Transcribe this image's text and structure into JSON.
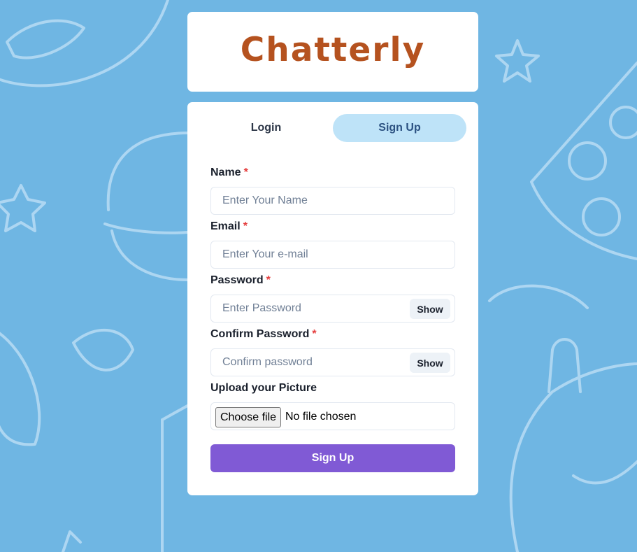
{
  "colors": {
    "background": "#6fb6e3",
    "doodle_stroke": "#b8dcf4",
    "title": "#b5521f",
    "tab_active_bg": "#bee3f8",
    "submit_bg": "#805ad5",
    "required": "#e53e3e"
  },
  "app": {
    "title": "Chatterly"
  },
  "tabs": [
    {
      "label": "Login",
      "active": false
    },
    {
      "label": "Sign Up",
      "active": true
    }
  ],
  "form": {
    "required_marker": "*",
    "name": {
      "label": "Name",
      "placeholder": "Enter Your Name",
      "value": ""
    },
    "email": {
      "label": "Email",
      "placeholder": "Enter Your e-mail",
      "value": ""
    },
    "password": {
      "label": "Password",
      "placeholder": "Enter Password",
      "value": "",
      "toggle_label": "Show"
    },
    "confirm_password": {
      "label": "Confirm Password",
      "placeholder": "Confirm password",
      "value": "",
      "toggle_label": "Show"
    },
    "picture": {
      "label": "Upload your Picture",
      "button_label": "Choose file",
      "status": "No file chosen"
    },
    "submit_label": "Sign Up"
  },
  "background_icons": [
    "star-icon",
    "bowl-icon",
    "burger-icon",
    "pizza-slice-icon",
    "cup-icon",
    "leaf-icon"
  ]
}
